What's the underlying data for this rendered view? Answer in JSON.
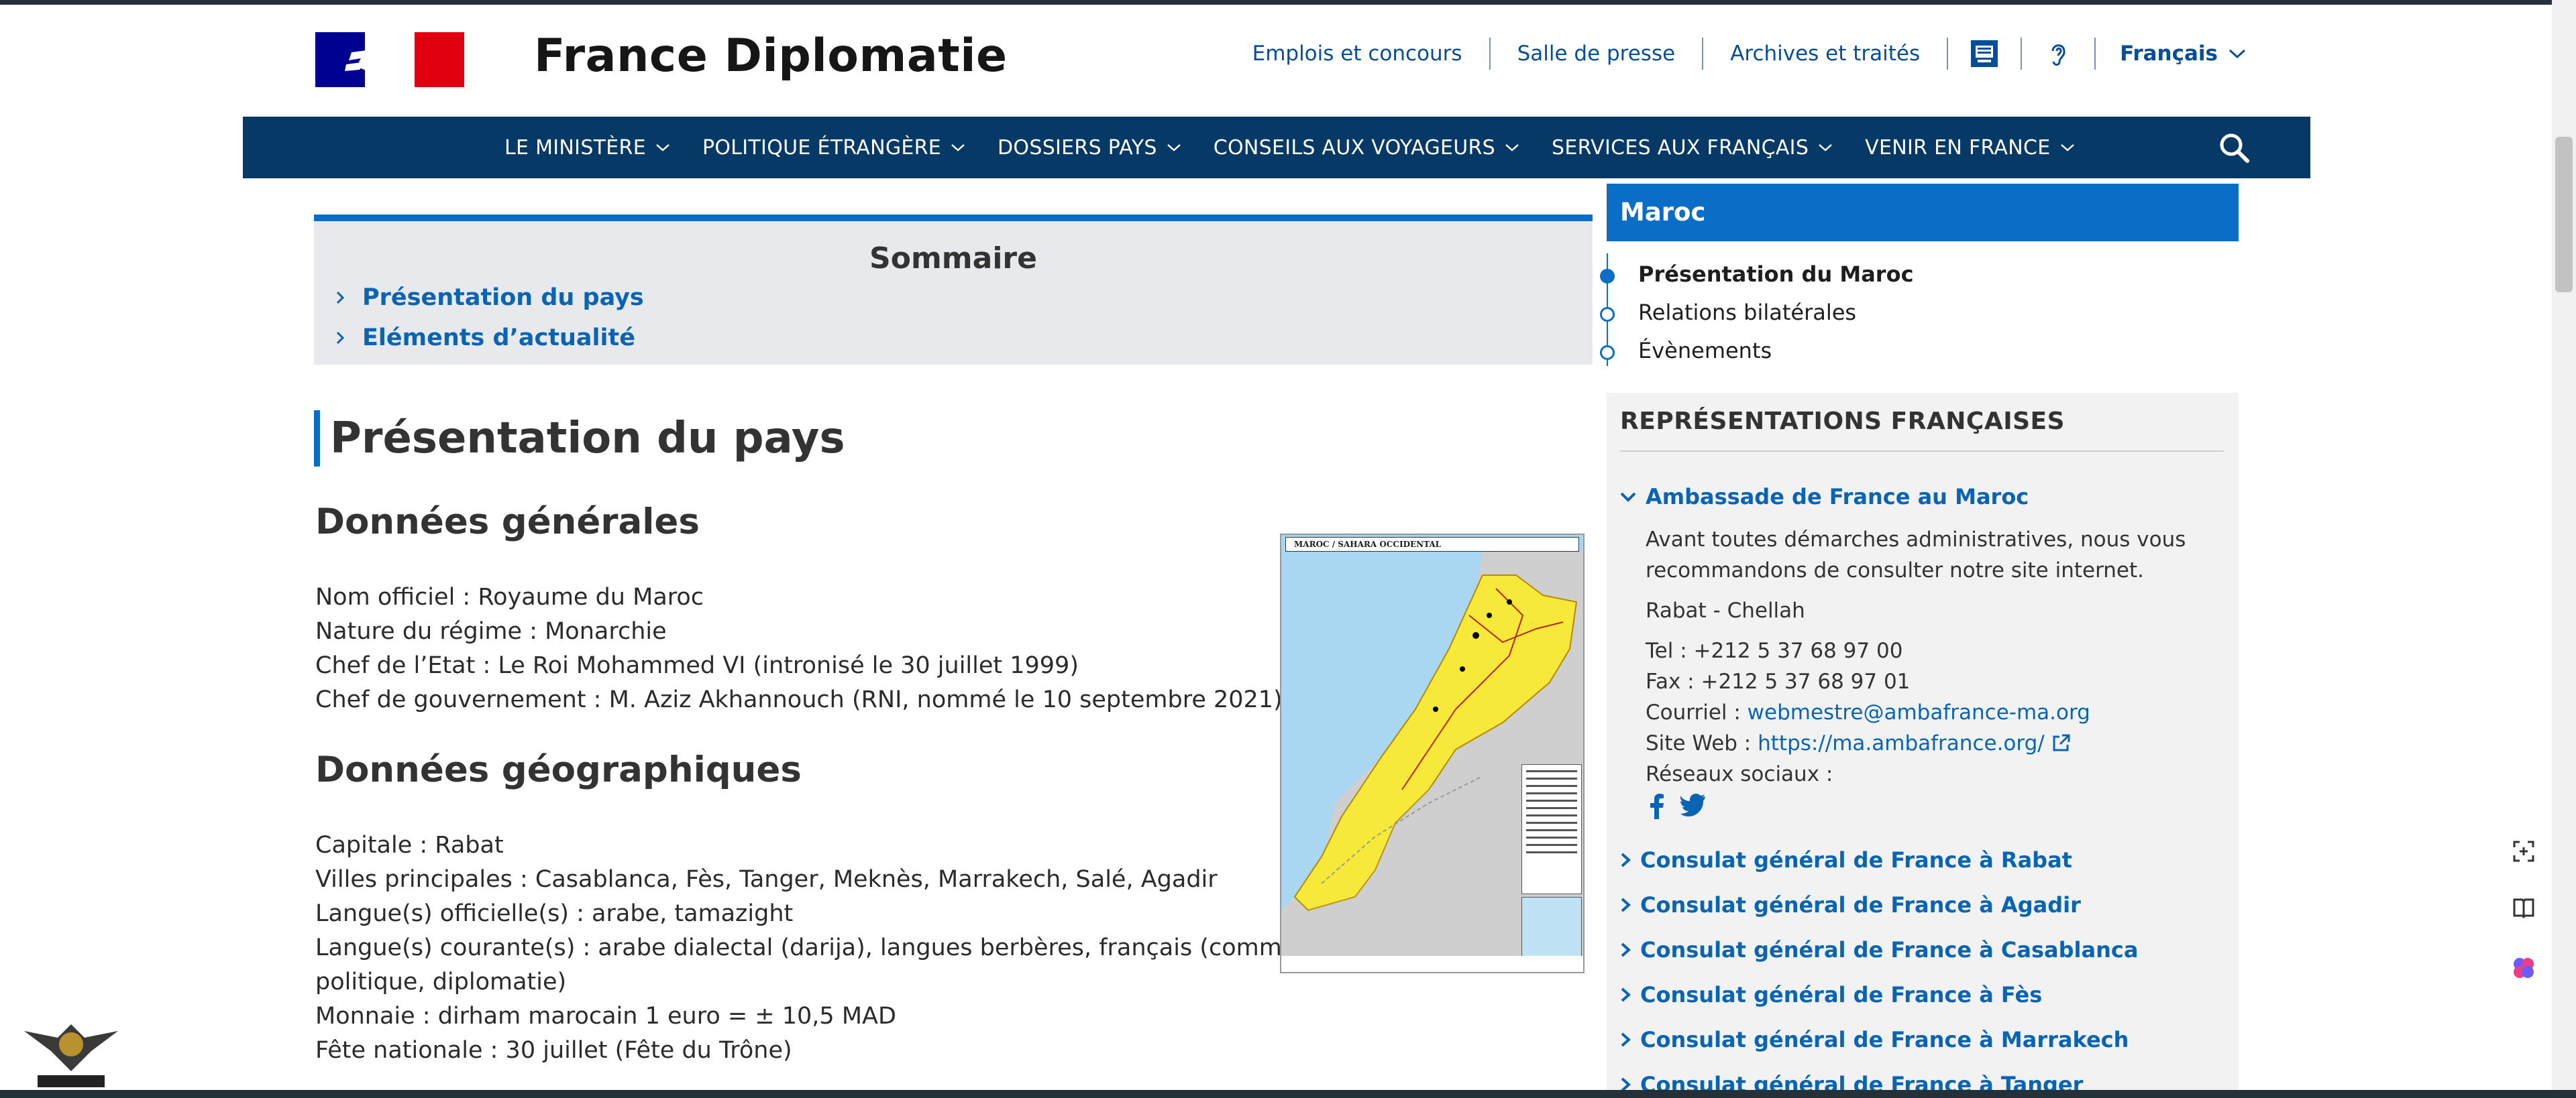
{
  "site": {
    "title": "France Diplomatie"
  },
  "toplinks": {
    "emplois": "Emplois et concours",
    "presse": "Salle de presse",
    "archives": "Archives et traités",
    "language": "Français"
  },
  "nav": {
    "items": [
      "LE MINISTÈRE",
      "POLITIQUE ÉTRANGÈRE",
      "DOSSIERS PAYS",
      "CONSEILS AUX VOYAGEURS",
      "SERVICES AUX FRANÇAIS",
      "VENIR EN FRANCE"
    ]
  },
  "sommaire": {
    "title": "Sommaire",
    "items": [
      "Présentation du pays",
      "Eléments d’actualité"
    ]
  },
  "main": {
    "title": "Présentation du pays",
    "generales": {
      "heading": "Données générales",
      "lines": [
        "Nom officiel : Royaume du Maroc",
        "Nature du régime : Monarchie",
        "Chef de l’Etat : Le Roi Mohammed VI (intronisé le 30 juillet 1999)",
        "Chef de gouvernement : M. Aziz Akhannouch (RNI, nommé le 10 septembre 2021)"
      ]
    },
    "geographiques": {
      "heading": "Données géographiques",
      "lines": [
        "Capitale : Rabat",
        "Villes principales : Casablanca, Fès, Tanger, Meknès, Marrakech, Salé, Agadir",
        "Langue(s) officielle(s) : arabe, tamazight",
        "Langue(s) courante(s) : arabe dialectal (darija), langues berbères, français (commerce,",
        "politique, diplomatie)",
        "Monnaie : dirham marocain 1 euro = ± 10,5 MAD",
        "Fête nationale : 30 juillet (Fête du Trône)"
      ]
    },
    "map": {
      "title": "MAROC / SAHARA OCCIDENTAL"
    }
  },
  "sidebar": {
    "title": "Maroc",
    "items": [
      "Présentation du Maroc",
      "Relations bilatérales",
      "Évènements"
    ],
    "active_index": 0
  },
  "representations": {
    "title": "REPRÉSENTATIONS FRANÇAISES",
    "ambassade": {
      "name": "Ambassade de France au Maroc",
      "note_line1": "Avant toutes démarches administratives, nous vous",
      "note_line2": "recommandons de consulter notre site internet.",
      "location": "Rabat - Chellah",
      "tel": "Tel : +212 5 37 68 97 00",
      "fax": "Fax : +212 5 37 68 97 01",
      "courriel_label": "Courriel : ",
      "courriel": "webmestre@ambafrance-ma.org",
      "site_label": "Site Web : ",
      "site": "https://ma.ambafrance.org/",
      "reseaux": "Réseaux sociaux :"
    },
    "consulats": [
      "Consulat général de France à Rabat",
      "Consulat général de France à Agadir",
      "Consulat général de France à Casablanca",
      "Consulat général de France à Fès",
      "Consulat général de France à Marrakech",
      "Consulat général de France à Tanger"
    ]
  },
  "colors": {
    "nav_bg": "#063966",
    "accent": "#0a6ec6",
    "link": "#0a64b4"
  }
}
